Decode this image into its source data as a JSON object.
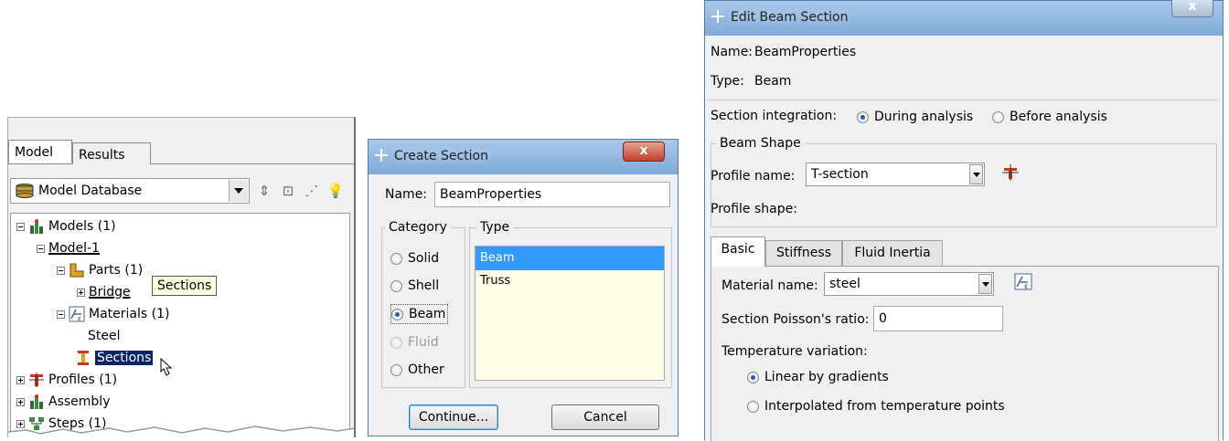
{
  "tree_panel": {
    "tabs": [
      "Model",
      "Results"
    ],
    "db_combo": "Model Database",
    "nodes": {
      "models": "Models (1)",
      "model1": "Model-1",
      "parts": "Parts (1)",
      "bridge": "Bridge",
      "materials": "Materials (1)",
      "steel": "Steel",
      "sections": "Sections",
      "profiles": "Profiles (1)",
      "assembly": "Assembly",
      "steps": "Steps (1)"
    },
    "tooltip": "Sections"
  },
  "create_section": {
    "title": "Create Section",
    "close": "x",
    "name_label": "Name:",
    "name_value": "BeamProperties",
    "category_label": "Category",
    "type_label": "Type",
    "categories": [
      "Solid",
      "Shell",
      "Beam",
      "Fluid",
      "Other"
    ],
    "selected_category": "Beam",
    "types": [
      "Beam",
      "Truss"
    ],
    "selected_type": "Beam",
    "continue": "Continue...",
    "cancel": "Cancel"
  },
  "edit_beam_section": {
    "title": "Edit Beam Section",
    "close": "x",
    "name_label": "Name:",
    "name_value": "BeamProperties",
    "type_label": "Type:",
    "type_value": "Beam",
    "integration_label": "Section integration:",
    "integration_options": [
      "During analysis",
      "Before analysis"
    ],
    "integration_selected": "During analysis",
    "beam_shape_group": "Beam Shape",
    "profile_name_label": "Profile name:",
    "profile_name_value": "T-section",
    "profile_shape_label": "Profile shape:",
    "tabs": [
      "Basic",
      "Stiffness",
      "Fluid Inertia"
    ],
    "active_tab": "Basic",
    "material_name_label": "Material name:",
    "material_name_value": "steel",
    "poisson_label": "Section Poisson's ratio:",
    "poisson_value": "0",
    "temp_variation_label": "Temperature variation:",
    "temp_options": [
      "Linear by gradients",
      "Interpolated from temperature points"
    ],
    "temp_selected": "Linear by gradients"
  },
  "colors": {
    "titlebar": "#8fb6e2",
    "selection": "#3399ff",
    "tree_selection": "#0a246a",
    "close_button": "#c0402a"
  }
}
